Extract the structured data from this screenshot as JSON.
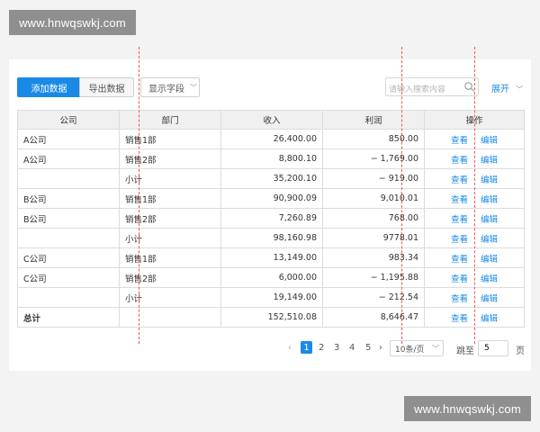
{
  "watermark": {
    "top": "www.hnwqswkj.com",
    "bottom": "www.hnwqswkj.com"
  },
  "toolbar": {
    "add_label": "添加数据",
    "export_label": "导出数据",
    "fields_label": "显示字段",
    "search_placeholder": "请输入搜索内容",
    "expand_label": "展开"
  },
  "table": {
    "headers": [
      "公司",
      "部门",
      "收入",
      "利润",
      "操作"
    ],
    "ops": {
      "view": "查看",
      "edit": "编辑"
    },
    "rows": [
      {
        "company": "A公司",
        "dept": "销售1部",
        "income": "26,400.00",
        "profit": "850.00"
      },
      {
        "company": "A公司",
        "dept": "销售2部",
        "income": "8,800.10",
        "profit": "− 1,769.00"
      },
      {
        "company": "",
        "dept": "小计",
        "income": "35,200.10",
        "profit": "− 919.00"
      },
      {
        "company": "B公司",
        "dept": "销售1部",
        "income": "90,900.09",
        "profit": "9,010.01"
      },
      {
        "company": "B公司",
        "dept": "销售2部",
        "income": "7,260.89",
        "profit": "768.00"
      },
      {
        "company": "",
        "dept": "小计",
        "income": "98,160.98",
        "profit": "9778.01"
      },
      {
        "company": "C公司",
        "dept": "销售1部",
        "income": "13,149.00",
        "profit": "983.34"
      },
      {
        "company": "C公司",
        "dept": "销售2部",
        "income": "6,000.00",
        "profit": "− 1,195.88"
      },
      {
        "company": "",
        "dept": "小计",
        "income": "19,149.00",
        "profit": "− 212.54"
      },
      {
        "company": "总计",
        "dept": "",
        "income": "152,510.08",
        "profit": "8,646.47"
      }
    ]
  },
  "pagination": {
    "prev": "‹",
    "pages": [
      "1",
      "2",
      "3",
      "4",
      "5"
    ],
    "current": "1",
    "next": "›",
    "page_size": "10条/页",
    "jump_label": "跳至",
    "jump_value": "5",
    "page_unit": "页"
  },
  "colors": {
    "accent": "#1a8ae6",
    "guide": "#e85a5a"
  }
}
